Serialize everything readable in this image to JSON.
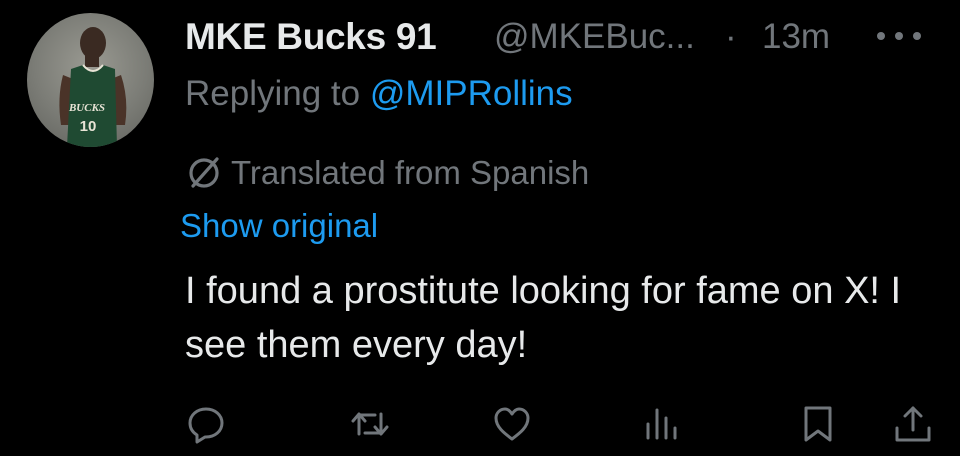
{
  "tweet": {
    "author": {
      "display_name": "MKE Bucks 91",
      "handle": "@MKEBuc...",
      "avatar_icon": "player-avatar",
      "jersey_text": "BUCKS",
      "jersey_number": "10"
    },
    "separator": "·",
    "timestamp": "13m",
    "more_icon": "more-dots-icon",
    "replying_prefix": "Replying to",
    "replying_to": "@MIPRollins",
    "translation": {
      "icon": "translate-icon",
      "label": "Translated from Spanish",
      "show_original": "Show original"
    },
    "text": "I found a prostitute looking for fame on X! I see them every day!",
    "actions": [
      {
        "name": "reply",
        "icon": "reply-icon"
      },
      {
        "name": "repost",
        "icon": "repost-icon"
      },
      {
        "name": "like",
        "icon": "heart-icon"
      },
      {
        "name": "views",
        "icon": "views-icon"
      },
      {
        "name": "bookmark",
        "icon": "bookmark-icon"
      },
      {
        "name": "share",
        "icon": "share-icon"
      }
    ]
  },
  "colors": {
    "background": "#000000",
    "primary_text": "#e7e9ea",
    "secondary_text": "#71767b",
    "link": "#1d9bf0"
  }
}
